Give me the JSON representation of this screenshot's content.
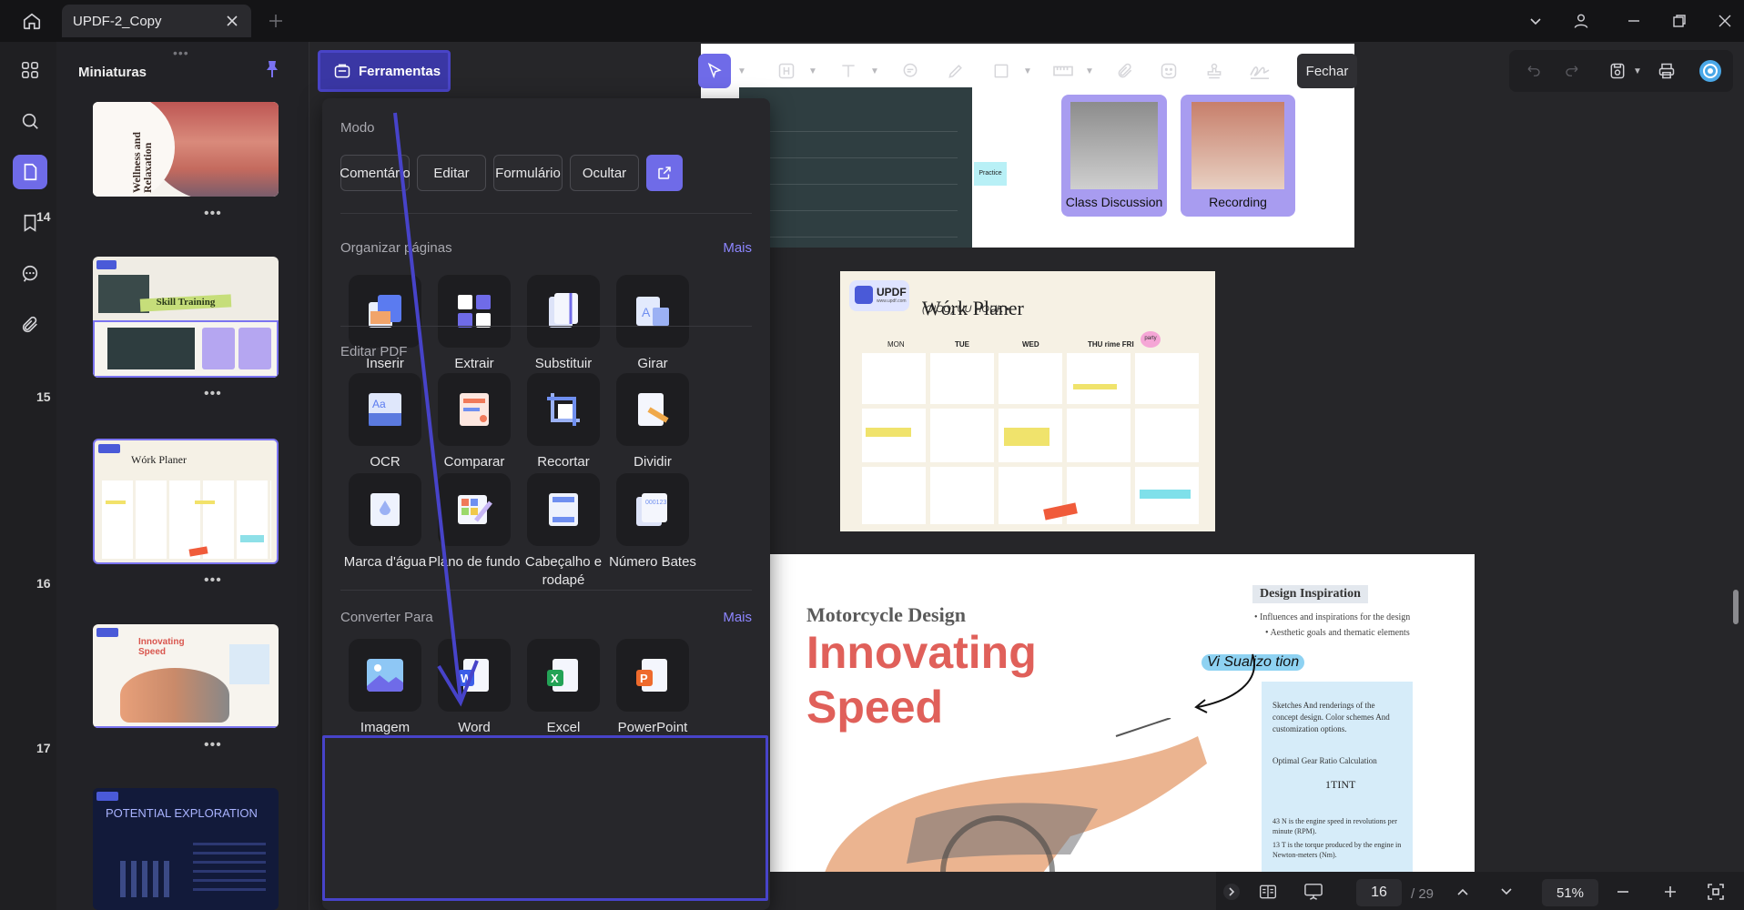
{
  "titlebar": {
    "tab_title": "UPDF-2_Copy"
  },
  "thumbnails": {
    "title": "Miniaturas",
    "items": [
      {
        "page": "14",
        "heading": "Wellness and Relaxation"
      },
      {
        "page": "15",
        "heading": "Skill Training"
      },
      {
        "page": "16",
        "heading": "Wórk Planer"
      },
      {
        "page": "17",
        "heading": "Innovating Speed"
      },
      {
        "page": "",
        "heading": "POTENTIAL EXPLORATION"
      }
    ]
  },
  "toolbar": {
    "tools_label": "Ferramentas",
    "close_label": "Fechar"
  },
  "panel": {
    "mode_title": "Modo",
    "modes": [
      "Comentário",
      "Editar",
      "Formulário",
      "Ocultar"
    ],
    "organize": {
      "title": "Organizar páginas",
      "more": "Mais",
      "items": [
        "Inserir",
        "Extrair",
        "Substituir",
        "Girar"
      ]
    },
    "edit": {
      "title": "Editar PDF",
      "items": [
        "OCR",
        "Comparar",
        "Recortar",
        "Dividir",
        "Marca d'água",
        "Plano de fundo",
        "Cabeçalho e rodapé",
        "Número Bates"
      ]
    },
    "convert": {
      "title": "Converter Para",
      "more": "Mais",
      "items": [
        "Imagem",
        "Word",
        "Excel",
        "PowerPoint"
      ]
    }
  },
  "document": {
    "page15": {
      "captions": [
        "Class Discussion",
        "Recording"
      ],
      "badge": "Practice"
    },
    "page16": {
      "logo": "UPDF",
      "logo_sub": "www.updf.com",
      "title": "Wórk Planer",
      "subtitle": "(OICO) UU HOUK •",
      "days": [
        "MON",
        "TUE",
        "WED",
        "THU rime FRI",
        ""
      ],
      "tag": "party"
    },
    "page17": {
      "kicker": "Motorcycle Design",
      "headline1": "Innovating",
      "headline2": "Speed",
      "side_title": "Design Inspiration",
      "bullets": [
        "• Influences and inspirations for the design",
        "• Aesthetic goals and thematic elements"
      ],
      "annotation": "Vi Sualizo tion",
      "note1": "Sketches And renderings of the concept design. Color schemes And customization options.",
      "note2": "Optimal Gear Ratio Calculation",
      "note3": "1TINT",
      "note4": "43 N is the engine speed in revolutions per minute (RPM).",
      "note5": "13 T is the torque produced by the engine in Newton-meters (Nm)."
    }
  },
  "status": {
    "page_current": "16",
    "page_total": "/ 29",
    "zoom": "51%"
  },
  "colors": {
    "accent": "#6f6be8",
    "highlight_border": "#4743c9",
    "headline": "#e0605a"
  }
}
